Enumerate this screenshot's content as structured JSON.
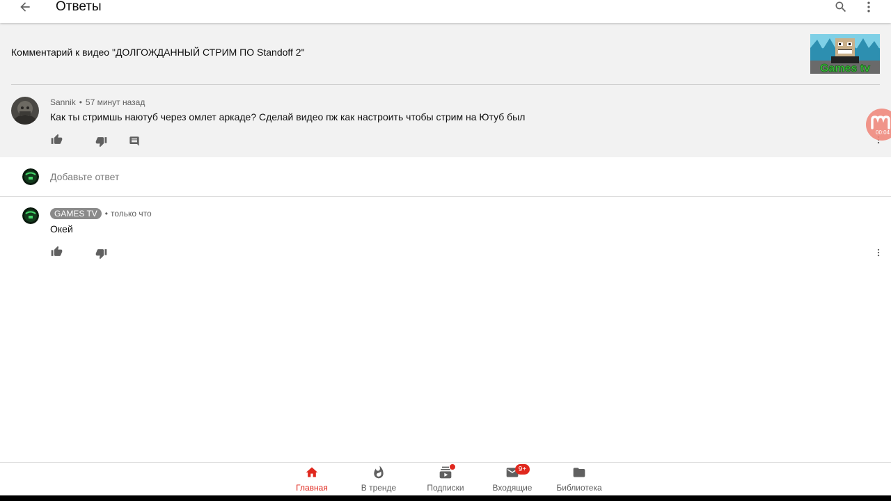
{
  "appbar": {
    "title": "Ответы",
    "icons": [
      "arrow-back-icon",
      "search-icon",
      "more-vert-icon"
    ]
  },
  "video": {
    "header_text": "Комментарий к видео \"ДОЛГОЖДАННЫЙ СТРИМ ПО Standoff 2\"",
    "thumbnail_text": "Games tv"
  },
  "parent_comment": {
    "author": "Sannik",
    "separator": "•",
    "time": "57 минут назад",
    "text": "Как ты стримшь наютуб через омлет аркаде? Сделай видео пж как настроить чтобы стрим на Ютуб был"
  },
  "recorder": {
    "time": "00:04"
  },
  "reply_box": {
    "placeholder": "Добавьте ответ",
    "value": ""
  },
  "replies": [
    {
      "author": "GAMES TV",
      "separator": "•",
      "time": "только что",
      "text": "Окей"
    }
  ],
  "bottom_nav": [
    {
      "label": "Главная",
      "icon": "home-icon",
      "active": true
    },
    {
      "label": "В тренде",
      "icon": "fire-icon",
      "active": false
    },
    {
      "label": "Подписки",
      "icon": "subscriptions-icon",
      "active": false
    },
    {
      "label": "Входящие",
      "icon": "mail-icon",
      "active": false,
      "badge": "9+"
    },
    {
      "label": "Библиотека",
      "icon": "folder-icon",
      "active": false
    }
  ],
  "colors": {
    "accent": "#e0281e",
    "header_bg": "#f2f2f2",
    "icon_gray": "#606060",
    "text": "#0f0f0f"
  }
}
